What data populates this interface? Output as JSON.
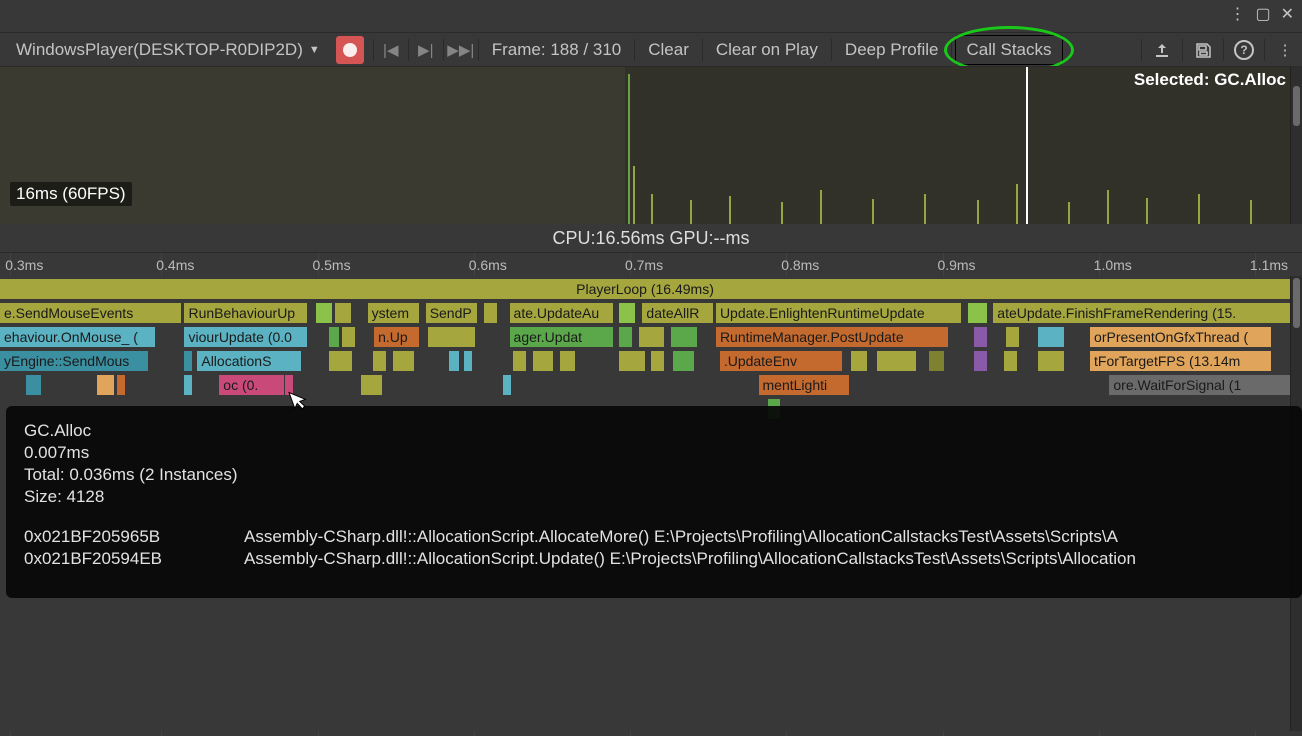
{
  "window": {
    "menu_icon": "⋮",
    "maximize_icon": "▢",
    "close_icon": "✕"
  },
  "toolbar": {
    "target": "WindowsPlayer(DESKTOP-R0DIP2D)",
    "frame_label": "Frame: 188 / 310",
    "clear": "Clear",
    "clear_on_play": "Clear on Play",
    "deep_profile": "Deep Profile",
    "call_stacks": "Call Stacks"
  },
  "overview": {
    "selected": "Selected: GC.Alloc",
    "fps_label": "16ms (60FPS)",
    "cursor_x_pct": 78.8
  },
  "cpu_summary": "CPU:16.56ms   GPU:--ms",
  "ruler": {
    "ticks": [
      "0.3ms",
      "0.4ms",
      "0.5ms",
      "0.6ms",
      "0.7ms",
      "0.8ms",
      "0.9ms",
      "1.0ms",
      "1.1ms"
    ]
  },
  "timeline_rows": {
    "r0": "PlayerLoop (16.49ms)",
    "r1": {
      "a": "e.SendMouseEvents",
      "b": "RunBehaviourUp",
      "c": "ystem",
      "d": "SendP",
      "e": "ate.UpdateAu",
      "f": "dateAllR",
      "g": "Update.EnlightenRuntimeUpdate",
      "h": "ateUpdate.FinishFrameRendering (15."
    },
    "r2": {
      "a": "ehaviour.OnMouse_ (",
      "b": "viourUpdate (0.0",
      "c": "n.Up",
      "d": "ager.Updat",
      "e": "RuntimeManager.PostUpdate",
      "f": "orPresentOnGfxThread ("
    },
    "r3": {
      "a": "yEngine::SendMous",
      "b": "AllocationS",
      "c": ".UpdateEnv",
      "d": "tForTargetFPS (13.14m"
    },
    "r4": {
      "a": "oc (0.",
      "b": "mentLighti",
      "c": "ore.WaitForSignal (1"
    }
  },
  "tooltip": {
    "title": "GC.Alloc",
    "time": "0.007ms",
    "total": "Total: 0.036ms (2 Instances)",
    "size": "Size: 4128",
    "stack": [
      {
        "addr": "0x021BF205965B",
        "sym": "Assembly-CSharp.dll!::AllocationScript.AllocateMore()    E:\\Projects\\Profiling\\AllocationCallstacksTest\\Assets\\Scripts\\A"
      },
      {
        "addr": "0x021BF20594EB",
        "sym": "Assembly-CSharp.dll!::AllocationScript.Update() E:\\Projects\\Profiling\\AllocationCallstacksTest\\Assets\\Scripts\\Allocation"
      }
    ]
  }
}
